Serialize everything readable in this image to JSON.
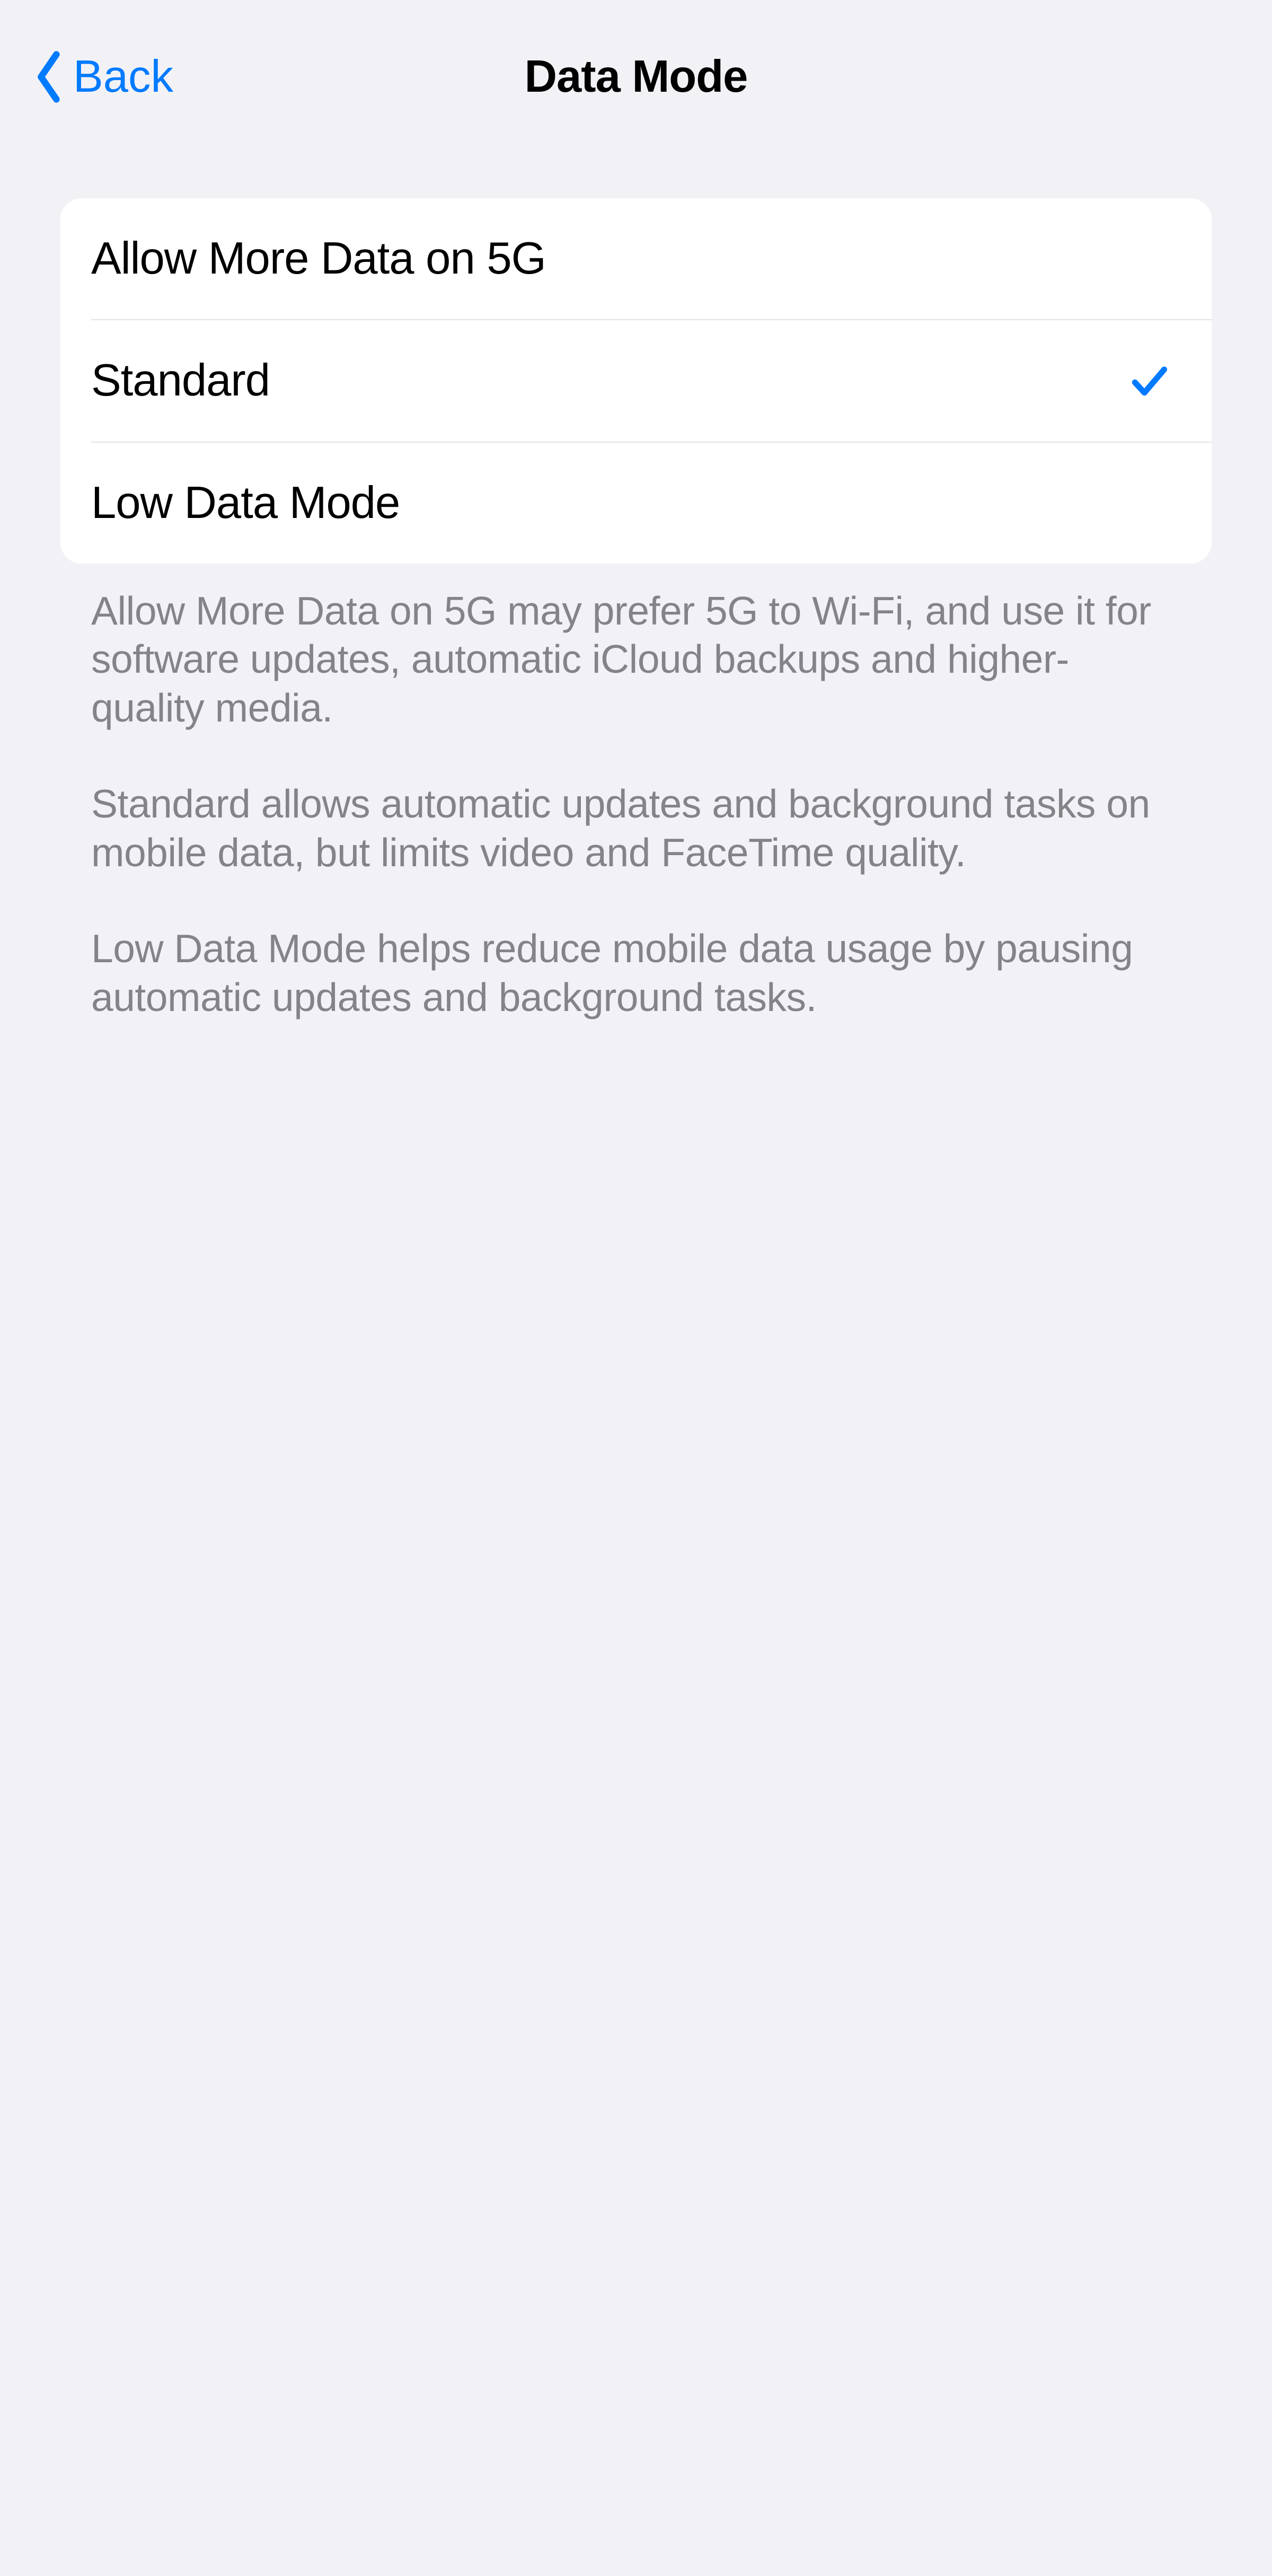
{
  "header": {
    "back_label": "Back",
    "title": "Data Mode"
  },
  "options": [
    {
      "label": "Allow More Data on 5G",
      "selected": false
    },
    {
      "label": "Standard",
      "selected": true
    },
    {
      "label": "Low Data Mode",
      "selected": false
    }
  ],
  "footer": {
    "p1": "Allow More Data on 5G may prefer 5G to Wi-Fi, and use it for software updates, automatic iCloud backups and higher-quality media.",
    "p2": "Standard allows automatic updates and background tasks on mobile data, but limits video and FaceTime quality.",
    "p3": "Low Data Mode helps reduce mobile data usage by pausing automatic updates and background tasks."
  },
  "colors": {
    "accent": "#007aff",
    "background": "#f2f2f6",
    "card": "#ffffff",
    "separator": "#e3e3e7",
    "footer_text": "#848488"
  }
}
